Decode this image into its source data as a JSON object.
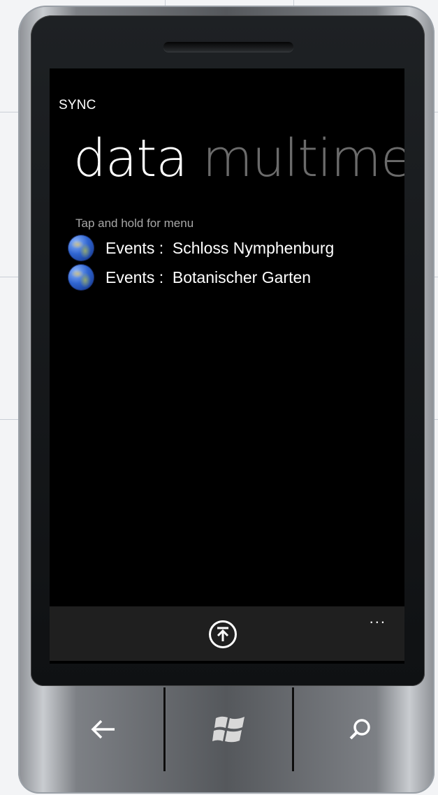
{
  "app": {
    "title": "SYNC"
  },
  "pivot": {
    "active_label": "data",
    "next_label": "multimec"
  },
  "list": {
    "hint": "Tap and hold for menu",
    "items": [
      {
        "label": "Events :  Schloss Nymphenburg",
        "icon": "globe-icon"
      },
      {
        "label": "Events :  Botanischer Garten",
        "icon": "globe-icon"
      }
    ]
  },
  "app_bar": {
    "more_label": "...",
    "button_icon": "upload-icon"
  },
  "hardware": {
    "back_icon": "back-arrow-icon",
    "start_icon": "windows-logo-icon",
    "search_icon": "search-icon"
  },
  "colors": {
    "screen": "#000000",
    "text": "#ffffff",
    "inactive_pivot": "#6b6b6b",
    "app_bar": "#1f1f1f"
  }
}
